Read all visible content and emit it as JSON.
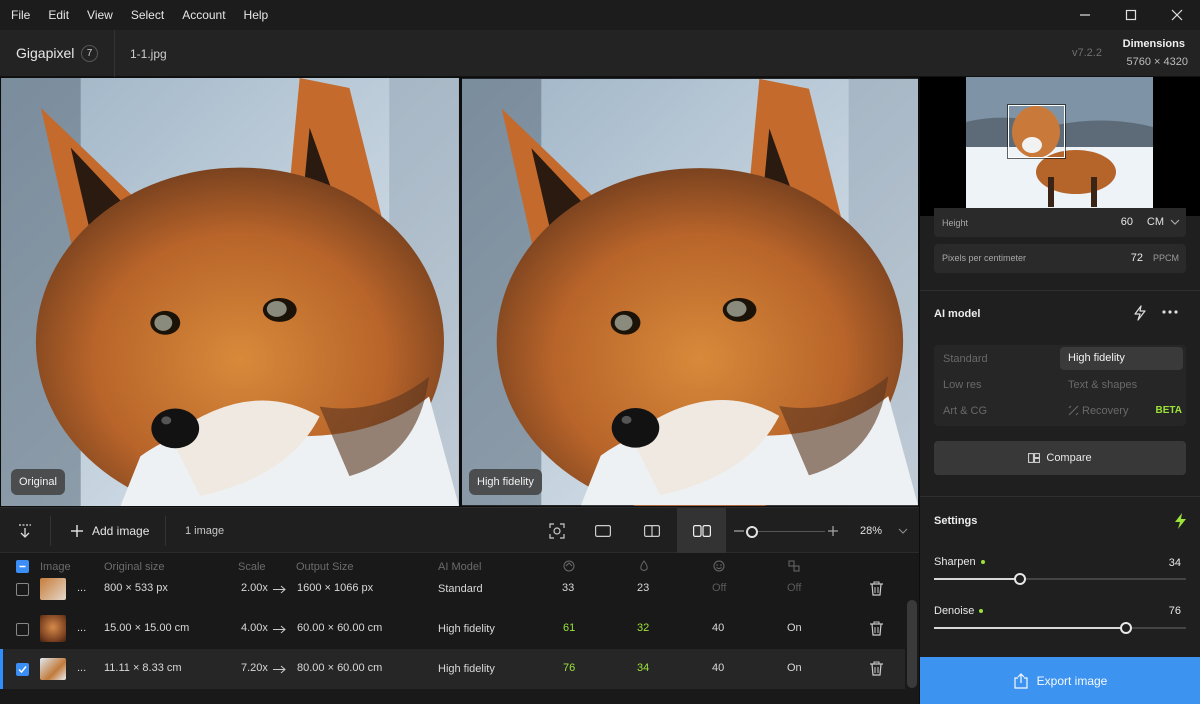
{
  "menu": [
    "File",
    "Edit",
    "View",
    "Select",
    "Account",
    "Help"
  ],
  "header": {
    "app_name": "Gigapixel",
    "badge": "7",
    "filename": "1-1.jpg",
    "version": "v7.2.2",
    "dimensions_label": "Dimensions",
    "dimensions_value": "5760 × 4320"
  },
  "preview": {
    "left_label": "Original",
    "right_label": "High fidelity"
  },
  "toolbar": {
    "add_image": "Add image",
    "count": "1 image",
    "zoom": "28%",
    "zoom_fraction": 0.05
  },
  "table": {
    "headers": [
      "Image",
      "Original size",
      "Scale",
      "Output Size",
      "AI Model"
    ],
    "rows": [
      {
        "original": "800 × 533 px",
        "scale": "2.00x",
        "output": "1600 × 1066 px",
        "model": "Standard",
        "c1": "33",
        "c2": "23",
        "c3": "Off",
        "c4": "Off",
        "selected": false
      },
      {
        "original": "15.00 × 15.00 cm",
        "scale": "4.00x",
        "output": "60.00 × 60.00 cm",
        "model": "High fidelity",
        "c1": "61",
        "c2": "32",
        "c3": "40",
        "c4": "On",
        "selected": false
      },
      {
        "original": "11.11 × 8.33 cm",
        "scale": "7.20x",
        "output": "80.00 × 60.00 cm",
        "model": "High fidelity",
        "c1": "76",
        "c2": "34",
        "c3": "40",
        "c4": "On",
        "selected": true
      }
    ],
    "ellipsis": "..."
  },
  "panel": {
    "height_label": "Height",
    "height_value": "60",
    "height_unit": "CM",
    "ppc_label": "Pixels per centimeter",
    "ppc_value": "72",
    "ppc_unit": "PPCM",
    "ai_model_title": "AI model",
    "models": {
      "standard": "Standard",
      "high_fidelity": "High fidelity",
      "low_res": "Low res",
      "text_shapes": "Text & shapes",
      "art_cg": "Art & CG",
      "recovery": "Recovery",
      "beta": "BETA"
    },
    "compare": "Compare",
    "settings_title": "Settings",
    "sharpen_label": "Sharpen",
    "sharpen_value": "34",
    "sharpen_fraction": 0.34,
    "denoise_label": "Denoise",
    "denoise_value": "76",
    "denoise_fraction": 0.76,
    "export": "Export image"
  },
  "colors": {
    "accent": "#3d93f0",
    "green": "#9be33a",
    "panel": "#1f1f1f"
  }
}
